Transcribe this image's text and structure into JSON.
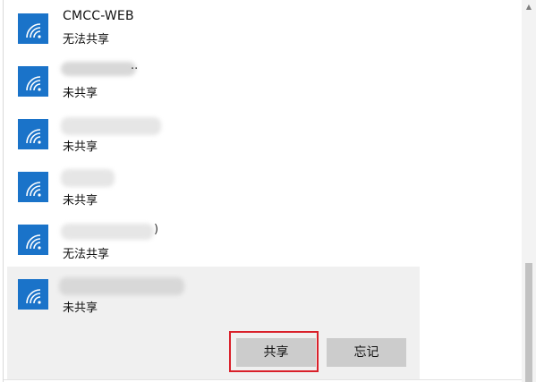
{
  "networks": [
    {
      "name": "CMCC-WEB",
      "status": "无法共享",
      "icon": "wifi-icon",
      "name_visible": true
    },
    {
      "name": "",
      "status": "未共享",
      "icon": "wifi-icon",
      "name_visible": false
    },
    {
      "name": "",
      "status": "未共享",
      "icon": "wifi-icon",
      "name_visible": false
    },
    {
      "name": "",
      "status": "未共享",
      "icon": "wifi-icon",
      "name_visible": false
    },
    {
      "name": "",
      "status": "无法共享",
      "icon": "wifi-icon",
      "name_visible": false
    },
    {
      "name": "",
      "status": "未共享",
      "icon": "wifi-icon",
      "name_visible": false,
      "selected": true
    }
  ],
  "actions": {
    "share_label": "共享",
    "forget_label": "忘记"
  },
  "colors": {
    "tile": "#1a73c9",
    "selected_bg": "#f0f0f0",
    "button_bg": "#cccccc",
    "highlight": "#d9202a",
    "scroll_thumb": "#c2c2c2"
  },
  "partial_glyphs": {
    "row2_suffix": "..",
    "row5_suffix": ")"
  }
}
